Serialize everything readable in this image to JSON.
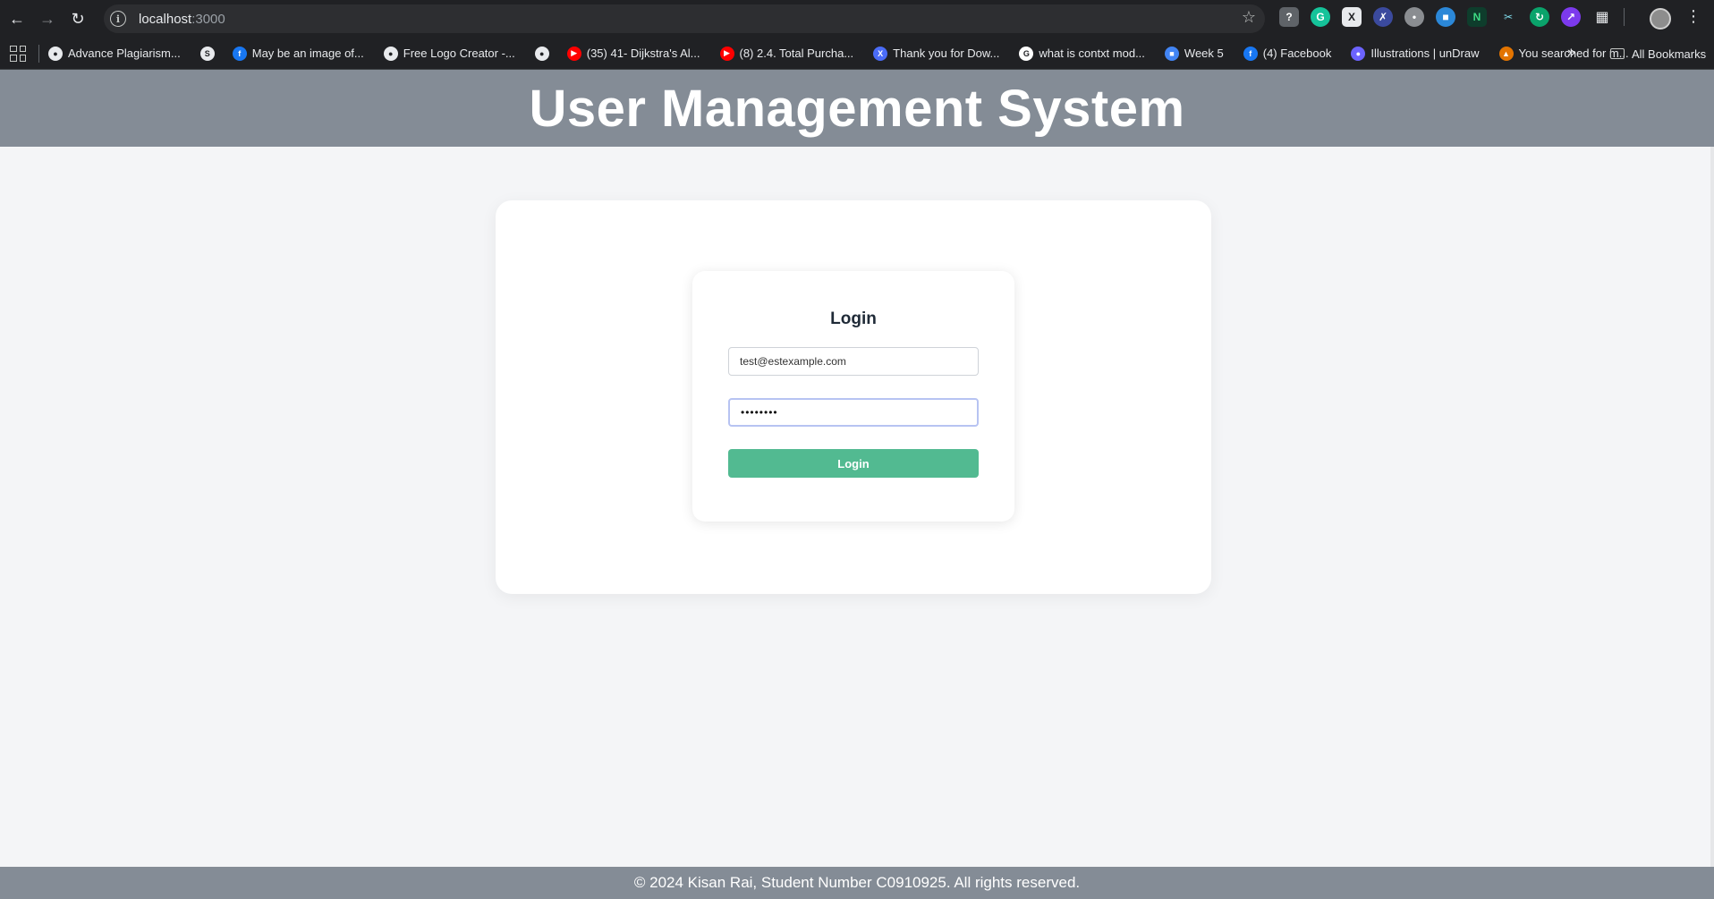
{
  "browser": {
    "url_host": "localhost",
    "url_port": ":3000",
    "bookmarks": [
      {
        "label": "Advance Plagiarism...",
        "icon": "globe-icon",
        "color": "#e8eaed"
      },
      {
        "label": "",
        "icon": "sst-icon",
        "color": "#e8eaed"
      },
      {
        "label": "May be an image of...",
        "icon": "facebook-icon",
        "color": "#1877f2"
      },
      {
        "label": "Free Logo Creator -...",
        "icon": "globe-icon",
        "color": "#e8eaed"
      },
      {
        "label": "",
        "icon": "globe-icon",
        "color": "#e8eaed"
      },
      {
        "label": "(35) 41- Dijkstra's Al...",
        "icon": "youtube-icon",
        "color": "#ff0000"
      },
      {
        "label": "(8) 2.4. Total Purcha...",
        "icon": "youtube-icon",
        "color": "#ff0000"
      },
      {
        "label": "Thank you for Dow...",
        "icon": "x-icon",
        "color": "#4a6cf7"
      },
      {
        "label": "what is contxt mod...",
        "icon": "google-icon",
        "color": "#ffffff"
      },
      {
        "label": "Week 5",
        "icon": "classroom-icon",
        "color": "#4285f4"
      },
      {
        "label": "(4) Facebook",
        "icon": "facebook-icon",
        "color": "#1877f2"
      },
      {
        "label": "Illustrations | unDraw",
        "icon": "undraw-icon",
        "color": "#6c63ff"
      },
      {
        "label": "You searched for m...",
        "icon": "fire-icon",
        "color": "#e37400"
      }
    ],
    "all_bookmarks_label": "All Bookmarks"
  },
  "header": {
    "title": "User Management System"
  },
  "login": {
    "title": "Login",
    "email_value": "test@estexample.com",
    "password_value": "••••••••",
    "button_label": "Login"
  },
  "footer": {
    "text": "© 2024 Kisan Rai, Student Number C0910925. All rights reserved."
  },
  "colors": {
    "header_bg": "#848c96",
    "button_bg": "#52ba91",
    "page_bg": "#f4f5f7"
  }
}
